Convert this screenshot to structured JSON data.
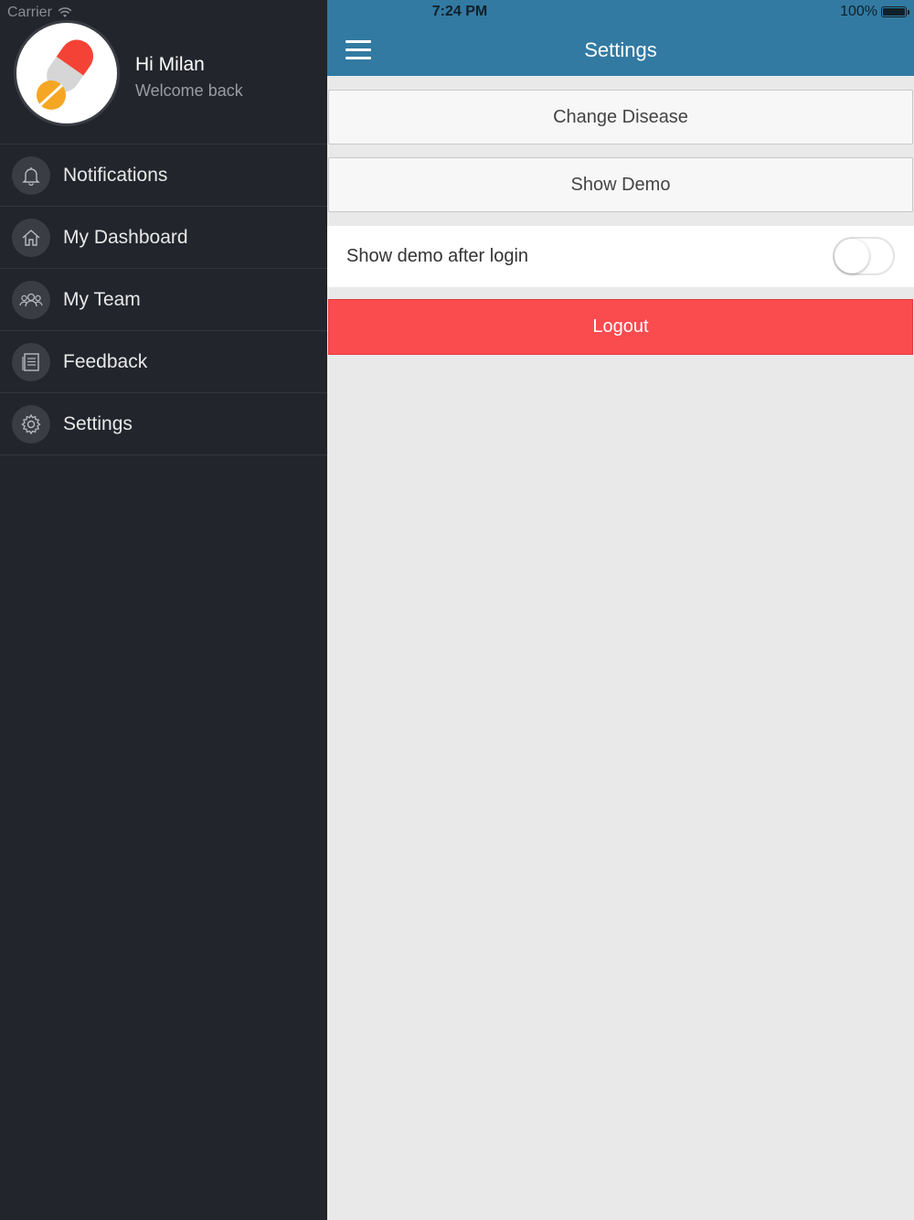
{
  "status_bar": {
    "carrier": "Carrier",
    "time": "7:24 PM",
    "battery": "100%"
  },
  "sidebar": {
    "greeting": "Hi Milan",
    "subtitle": "Welcome back",
    "items": [
      {
        "label": "Notifications",
        "icon": "bell-icon"
      },
      {
        "label": "My Dashboard",
        "icon": "home-icon"
      },
      {
        "label": "My Team",
        "icon": "team-icon"
      },
      {
        "label": "Feedback",
        "icon": "document-icon"
      },
      {
        "label": "Settings",
        "icon": "gear-icon"
      }
    ]
  },
  "header": {
    "title": "Settings"
  },
  "settings": {
    "change_disease_label": "Change Disease",
    "show_demo_label": "Show Demo",
    "show_demo_after_login_label": "Show demo after login",
    "show_demo_after_login_enabled": false,
    "logout_label": "Logout"
  },
  "colors": {
    "header": "#327aa2",
    "sidebar": "#22252c",
    "logout": "#fa4b4e",
    "background": "#e9e9e9"
  }
}
